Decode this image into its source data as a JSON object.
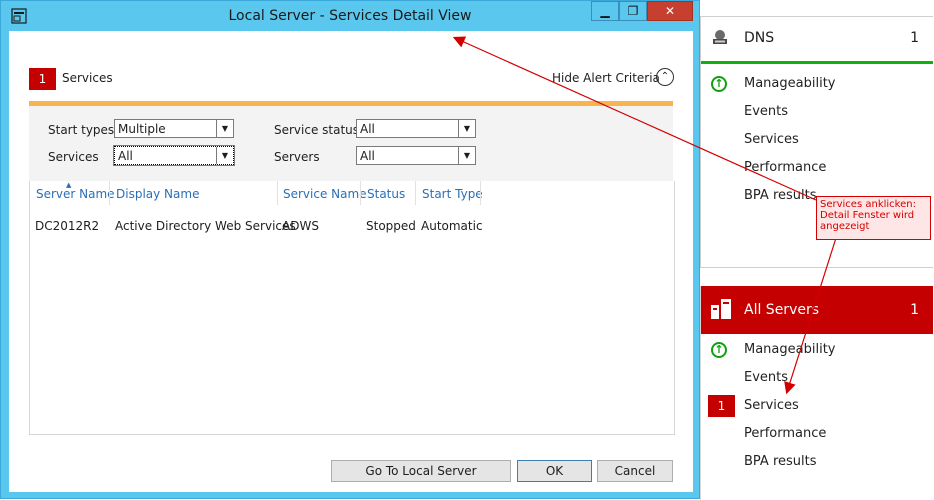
{
  "dialog": {
    "title": "Local Server - Services Detail View",
    "window_buttons": {
      "minimize": "▁",
      "maximize": "❐",
      "close": "✕"
    }
  },
  "alert": {
    "count": "1",
    "label": "Services",
    "hide_criteria": "Hide Alert Criteria"
  },
  "filters": {
    "start_types_label": "Start types",
    "start_types_value": "Multiple",
    "services_label": "Services",
    "services_value": "All",
    "service_status_label": "Service status",
    "service_status_value": "All",
    "servers_label": "Servers",
    "servers_value": "All"
  },
  "grid": {
    "columns": [
      "Server Name",
      "Display Name",
      "Service Name",
      "Status",
      "Start Type"
    ],
    "rows": [
      [
        "DC2012R2",
        "Active Directory Web Services",
        "ADWS",
        "Stopped",
        "Automatic"
      ]
    ]
  },
  "buttons": {
    "go_to": "Go To Local Server",
    "ok": "OK",
    "cancel": "Cancel"
  },
  "dns_tile": {
    "title": "DNS",
    "count": "1",
    "items": [
      "Manageability",
      "Events",
      "Services",
      "Performance",
      "BPA results"
    ]
  },
  "all_servers_tile": {
    "title": "All Servers",
    "count": "1",
    "items": [
      "Manageability",
      "Events",
      "Services",
      "Performance",
      "BPA results"
    ],
    "services_badge": "1"
  },
  "annotation": {
    "text": "Services anklicken: Detail Fenster wird angezeigt"
  },
  "colors": {
    "accent_blue": "#5ac7ee",
    "alert_red": "#c40000",
    "ok_green": "#10a010",
    "filter_orange": "#f9b54d",
    "annotation_red": "#d40000"
  }
}
